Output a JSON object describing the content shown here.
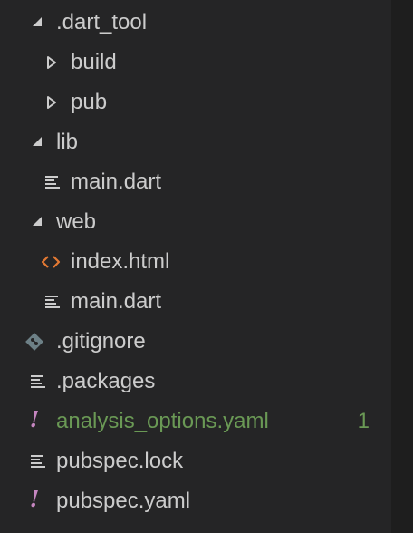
{
  "tree": {
    "rows": [
      {
        "label": ".dart_tool",
        "icon": "chevron-expanded-icon",
        "kind": "folder",
        "expanded": true
      },
      {
        "label": "build",
        "icon": "chevron-collapsed-icon",
        "kind": "folder",
        "expanded": false
      },
      {
        "label": "pub",
        "icon": "chevron-collapsed-icon",
        "kind": "folder",
        "expanded": false
      },
      {
        "label": "lib",
        "icon": "chevron-expanded-icon",
        "kind": "folder",
        "expanded": true
      },
      {
        "label": "main.dart",
        "icon": "lines-file-icon",
        "kind": "file"
      },
      {
        "label": "web",
        "icon": "chevron-expanded-icon",
        "kind": "folder",
        "expanded": true
      },
      {
        "label": "index.html",
        "icon": "html-code-icon",
        "kind": "file"
      },
      {
        "label": "main.dart",
        "icon": "lines-file-icon",
        "kind": "file"
      },
      {
        "label": ".gitignore",
        "icon": "git-diamond-icon",
        "kind": "file"
      },
      {
        "label": ".packages",
        "icon": "lines-file-icon",
        "kind": "file"
      },
      {
        "label": "analysis_options.yaml",
        "icon": "exclamation-icon",
        "kind": "file",
        "problems": "1",
        "status_color": "#6a9955"
      },
      {
        "label": "pubspec.lock",
        "icon": "lines-file-icon",
        "kind": "file"
      },
      {
        "label": "pubspec.yaml",
        "icon": "exclamation-icon",
        "kind": "file"
      }
    ]
  },
  "colors": {
    "background": "#252526",
    "text": "#cccccc",
    "modified_green": "#6a9955",
    "yaml_icon": "#c586c0",
    "html_icon": "#e37933",
    "git_icon": "#6d8086"
  }
}
